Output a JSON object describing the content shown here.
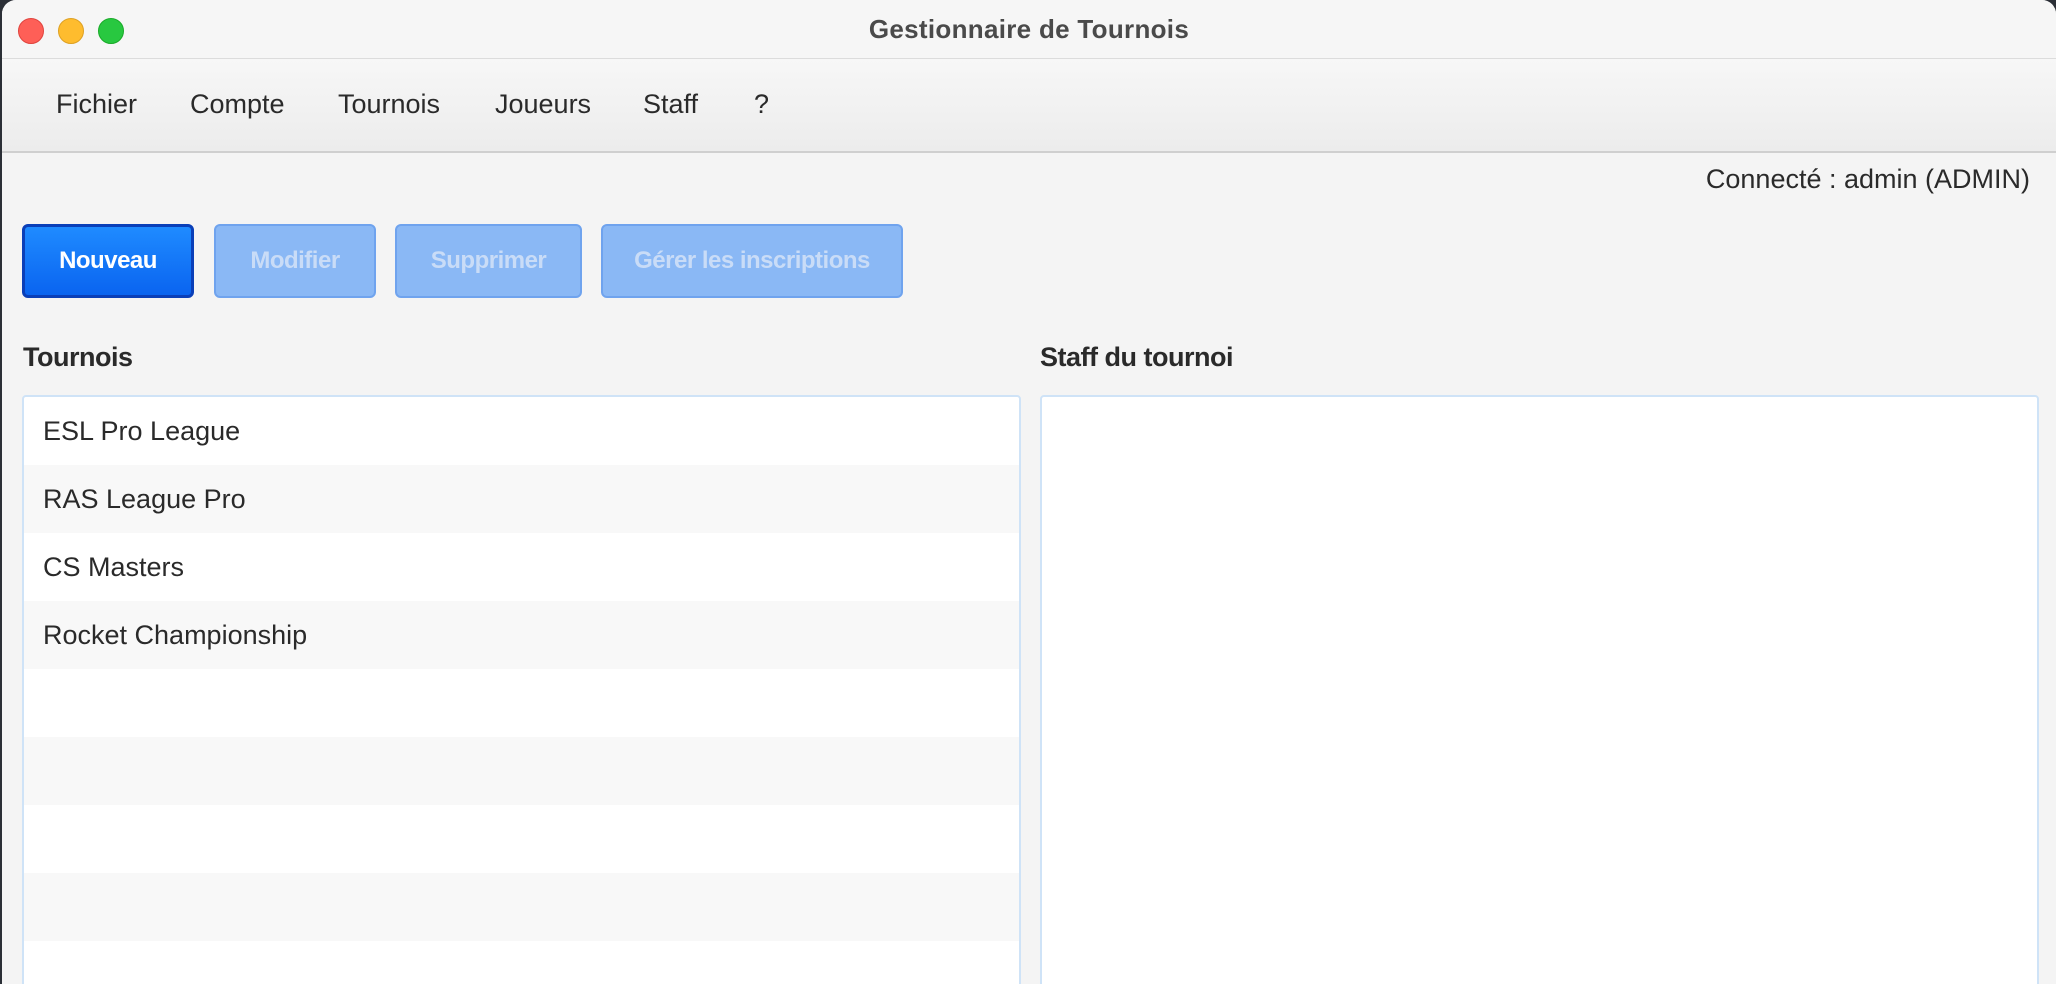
{
  "window": {
    "title": "Gestionnaire de Tournois"
  },
  "menu": {
    "items": [
      {
        "label": "Fichier"
      },
      {
        "label": "Compte"
      },
      {
        "label": "Tournois"
      },
      {
        "label": "Joueurs"
      },
      {
        "label": "Staff"
      },
      {
        "label": "?"
      }
    ]
  },
  "status": {
    "connected_label": "Connecté : admin (ADMIN)"
  },
  "toolbar": {
    "new_label": "Nouveau",
    "edit_label": "Modifier",
    "delete_label": "Supprimer",
    "registrations_label": "Gérer les inscriptions"
  },
  "tournaments": {
    "heading": "Tournois",
    "rows": [
      {
        "label": "ESL Pro League"
      },
      {
        "label": "RAS League Pro"
      },
      {
        "label": "CS Masters"
      },
      {
        "label": "Rocket Championship"
      },
      {
        "label": ""
      },
      {
        "label": ""
      },
      {
        "label": ""
      },
      {
        "label": ""
      },
      {
        "label": ""
      }
    ]
  },
  "staff": {
    "heading": "Staff du tournoi"
  }
}
